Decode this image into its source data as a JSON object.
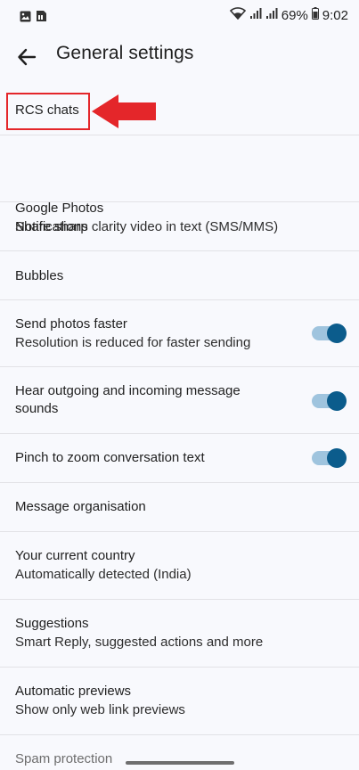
{
  "status_bar": {
    "battery": "69%",
    "time": "9:02",
    "left_icons": [
      "gallery-icon",
      "sim-card-icon"
    ],
    "right_icons": [
      "wifi-icon",
      "signal-icon",
      "signal-icon",
      "battery-icon"
    ]
  },
  "app_bar": {
    "back_icon": "arrow-back-icon",
    "title": "General settings"
  },
  "settings": [
    {
      "title": "RCS chats",
      "subtitle": null,
      "toggle": null
    },
    {
      "title": "Google Photos",
      "subtitle": "Share sharp clarity video in text (SMS/MMS)",
      "toggle": null
    },
    {
      "title": "Notifications",
      "subtitle": null,
      "toggle": null
    },
    {
      "title": "Bubbles",
      "subtitle": null,
      "toggle": null
    },
    {
      "title": "Send photos faster",
      "subtitle": "Resolution is reduced for faster sending",
      "toggle": true
    },
    {
      "title": "Hear outgoing and incoming message sounds",
      "subtitle": null,
      "toggle": true
    },
    {
      "title": "Pinch to zoom conversation text",
      "subtitle": null,
      "toggle": true
    },
    {
      "title": "Message organisation",
      "subtitle": null,
      "toggle": null
    },
    {
      "title": "Your current country",
      "subtitle": "Automatically detected (India)",
      "toggle": null
    },
    {
      "title": "Suggestions",
      "subtitle": "Smart Reply, suggested actions and more",
      "toggle": null
    },
    {
      "title": "Automatic previews",
      "subtitle": "Show only web link previews",
      "toggle": null
    },
    {
      "title": "Spam protection",
      "subtitle": null,
      "toggle": null
    }
  ],
  "colors": {
    "background": "#f8f9fd",
    "toggle_track": "#9fc4de",
    "toggle_knob": "#0b5c8c",
    "highlight": "#e4262a"
  }
}
